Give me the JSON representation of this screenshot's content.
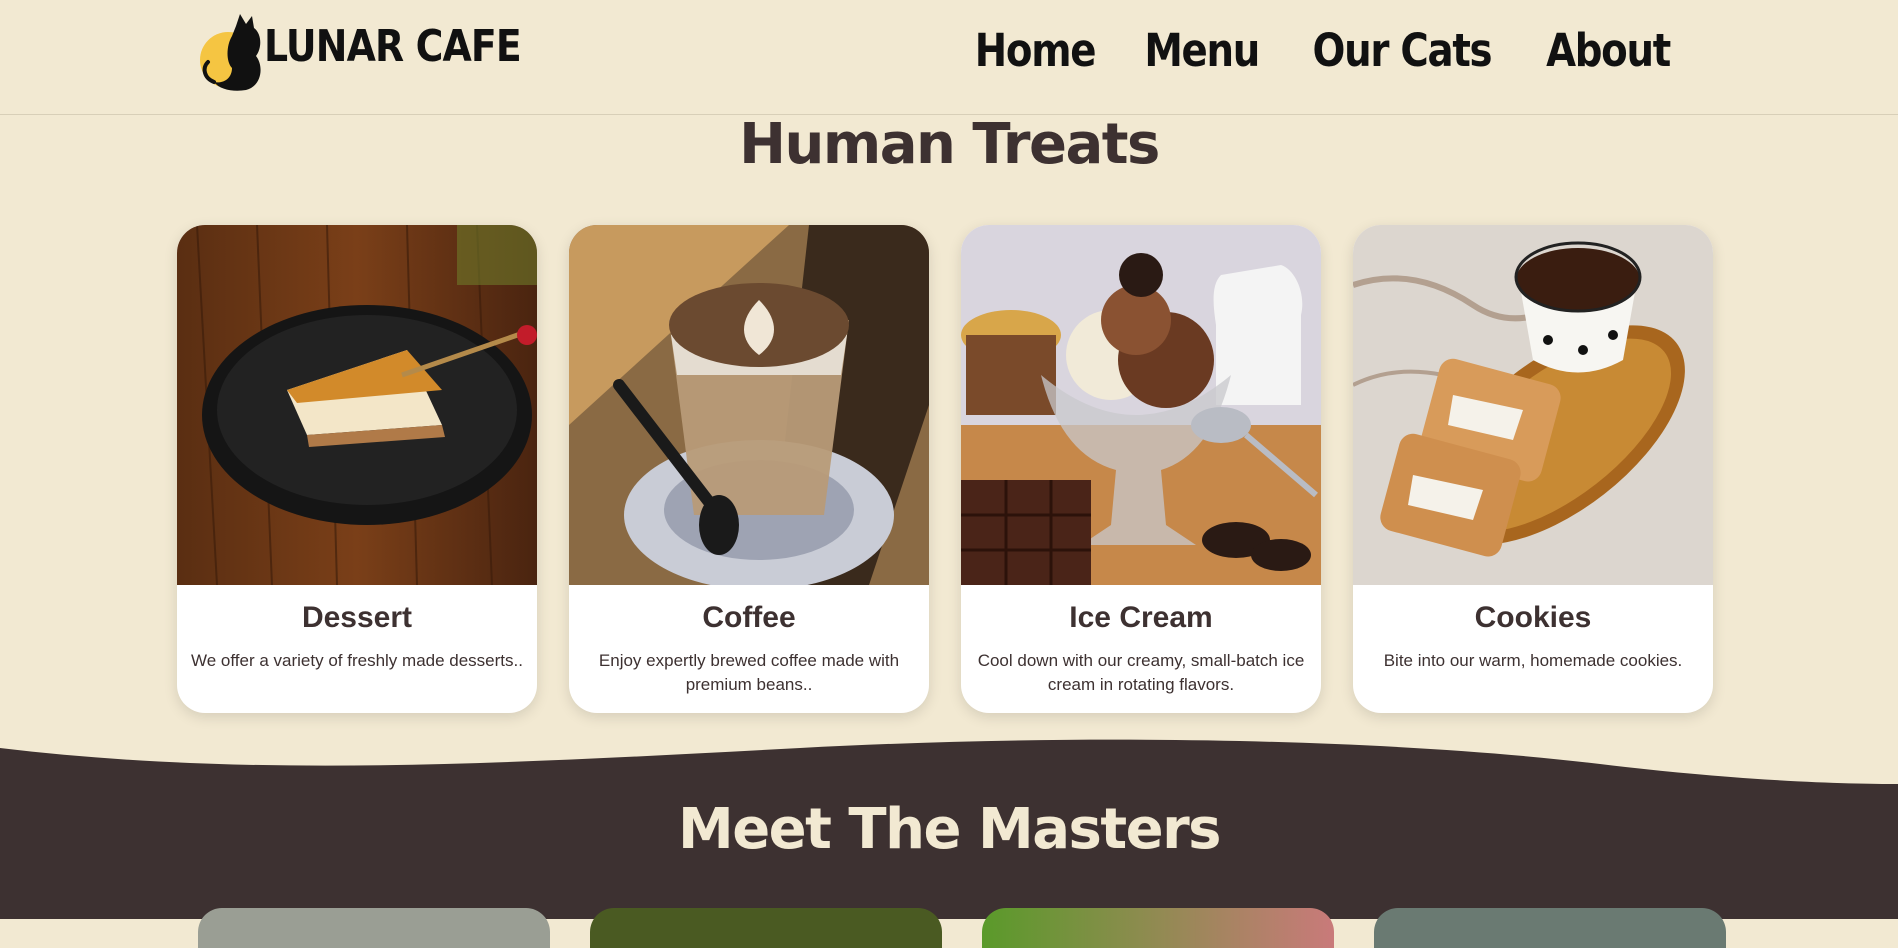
{
  "header": {
    "logo_text": "LUNAR CAFE",
    "nav": [
      {
        "label": "Home"
      },
      {
        "label": "Menu"
      },
      {
        "label": "Our Cats"
      },
      {
        "label": "About"
      }
    ]
  },
  "treats": {
    "title": "Human Treats",
    "cards": [
      {
        "title": "Dessert",
        "description": "We offer a variety of freshly made desserts..",
        "image": "cheesecake-slice-photo"
      },
      {
        "title": "Coffee",
        "description": "Enjoy expertly brewed coffee made with premium beans..",
        "image": "latte-art-coffee-photo"
      },
      {
        "title": "Ice Cream",
        "description": "Cool down with our creamy, small-batch ice cream in rotating flavors.",
        "image": "ice-cream-sundae-photo"
      },
      {
        "title": "Cookies",
        "description": "Bite into our warm, homemade cookies.",
        "image": "cookies-and-coffee-photo"
      }
    ]
  },
  "masters": {
    "title": "Meet The Masters"
  },
  "colors": {
    "background": "#f2e9d2",
    "dark": "#3d3131",
    "accent": "#f5c542"
  }
}
